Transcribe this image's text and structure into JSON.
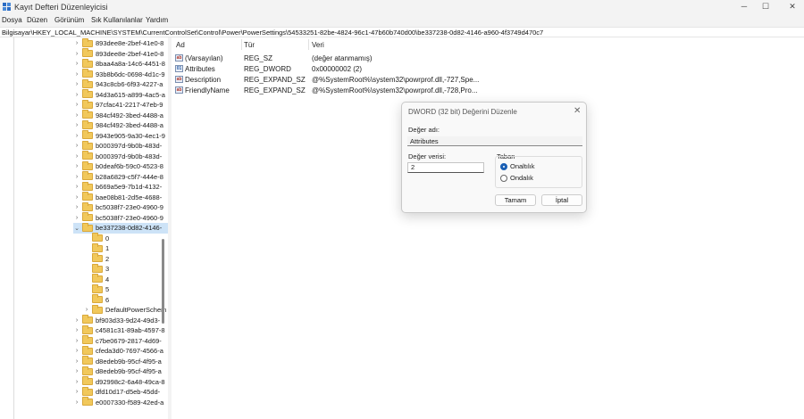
{
  "window": {
    "title": "Kayıt Defteri Düzenleyicisi",
    "minimize_glyph": "─",
    "maximize_glyph": "☐",
    "close_glyph": "✕",
    "icon": "registry-editor-icon"
  },
  "menu": [
    "Dosya",
    "Düzen",
    "Görünüm",
    "Sık Kullanılanlar",
    "Yardım"
  ],
  "address": "Bilgisayar\\HKEY_LOCAL_MACHINE\\SYSTEM\\CurrentControlSet\\Control\\Power\\PowerSettings\\54533251-82be-4824-96c1-47b60b740d00\\be337238-0d82-4146-a960-4f3749d470c7",
  "tree": {
    "chevron_collapsed": "›",
    "chevron_expanded": "⌄",
    "items": [
      {
        "label": "893dee8e-2bef-41e0-8",
        "level": 0,
        "state": "collapsed"
      },
      {
        "label": "893dee8e-2bef-41e0-8",
        "level": 0,
        "state": "collapsed"
      },
      {
        "label": "8baa4a8a-14c6-4451-8",
        "level": 0,
        "state": "collapsed"
      },
      {
        "label": "93b8b6dc-0698-4d1c-9",
        "level": 0,
        "state": "collapsed"
      },
      {
        "label": "943c8cb6-6f93-4227-a",
        "level": 0,
        "state": "collapsed"
      },
      {
        "label": "94d3a615-a899-4ac5-a",
        "level": 0,
        "state": "collapsed"
      },
      {
        "label": "97cfac41-2217-47eb-9",
        "level": 0,
        "state": "collapsed"
      },
      {
        "label": "984cf492-3bed-4488-a",
        "level": 0,
        "state": "collapsed"
      },
      {
        "label": "984cf492-3bed-4488-a",
        "level": 0,
        "state": "collapsed"
      },
      {
        "label": "9943e905-9a30-4ec1-9",
        "level": 0,
        "state": "collapsed"
      },
      {
        "label": "b000397d-9b0b-483d-",
        "level": 0,
        "state": "collapsed"
      },
      {
        "label": "b000397d-9b0b-483d-",
        "level": 0,
        "state": "collapsed"
      },
      {
        "label": "b0deaf6b-59c0-4523-8",
        "level": 0,
        "state": "collapsed"
      },
      {
        "label": "b28a6829-c5f7-444e-8",
        "level": 0,
        "state": "collapsed"
      },
      {
        "label": "b669a5e9-7b1d-4132-",
        "level": 0,
        "state": "collapsed"
      },
      {
        "label": "bae08b81-2d5e-4688-",
        "level": 0,
        "state": "collapsed"
      },
      {
        "label": "bc5038f7-23e0-4960-9",
        "level": 0,
        "state": "collapsed"
      },
      {
        "label": "bc5038f7-23e0-4960-9",
        "level": 0,
        "state": "collapsed"
      },
      {
        "label": "be337238-0d82-4146-",
        "level": 0,
        "state": "expanded",
        "selected": true
      },
      {
        "label": "0",
        "level": 1,
        "state": "leaf"
      },
      {
        "label": "1",
        "level": 1,
        "state": "leaf"
      },
      {
        "label": "2",
        "level": 1,
        "state": "leaf"
      },
      {
        "label": "3",
        "level": 1,
        "state": "leaf"
      },
      {
        "label": "4",
        "level": 1,
        "state": "leaf"
      },
      {
        "label": "5",
        "level": 1,
        "state": "leaf"
      },
      {
        "label": "6",
        "level": 1,
        "state": "leaf"
      },
      {
        "label": "DefaultPowerSchem",
        "level": 1,
        "state": "collapsed"
      },
      {
        "label": "bf903d33-9d24-49d3-",
        "level": 0,
        "state": "collapsed"
      },
      {
        "label": "c4581c31-89ab-4597-8",
        "level": 0,
        "state": "collapsed"
      },
      {
        "label": "c7be0679-2817-4d69-",
        "level": 0,
        "state": "collapsed"
      },
      {
        "label": "cfeda3d0-7697-4566-a",
        "level": 0,
        "state": "collapsed"
      },
      {
        "label": "d8edeb9b-95cf-4f95-a",
        "level": 0,
        "state": "collapsed"
      },
      {
        "label": "d8edeb9b-95cf-4f95-a",
        "level": 0,
        "state": "collapsed"
      },
      {
        "label": "d92998c2-6a48-49ca-8",
        "level": 0,
        "state": "collapsed"
      },
      {
        "label": "dfd10d17-d5eb-45dd-",
        "level": 0,
        "state": "collapsed"
      },
      {
        "label": "e0007330-f589-42ed-a",
        "level": 0,
        "state": "collapsed"
      }
    ]
  },
  "values": {
    "columns": {
      "name": "Ad",
      "type": "Tür",
      "data": "Veri"
    },
    "rows": [
      {
        "icon": "string-value-icon",
        "icon_text": "ab",
        "name": "(Varsayılan)",
        "type": "REG_SZ",
        "data": "(değer atanmamış)"
      },
      {
        "icon": "binary-value-icon",
        "icon_text": "01",
        "name": "Attributes",
        "type": "REG_DWORD",
        "data": "0x00000002 (2)"
      },
      {
        "icon": "string-value-icon",
        "icon_text": "ab",
        "name": "Description",
        "type": "REG_EXPAND_SZ",
        "data": "@%SystemRoot%\\system32\\powrprof.dll,-727,Spe..."
      },
      {
        "icon": "string-value-icon",
        "icon_text": "ab",
        "name": "FriendlyName",
        "type": "REG_EXPAND_SZ",
        "data": "@%SystemRoot%\\system32\\powrprof.dll,-728,Pro..."
      }
    ]
  },
  "dialog": {
    "title": "DWORD (32 bit) Değerini Düzenle",
    "close_glyph": "✕",
    "value_name_label": "Değer adı:",
    "value_name": "Attributes",
    "value_data_label": "Değer verisi:",
    "value_data": "2",
    "base_label": "Taban",
    "base_options": [
      {
        "label": "Onaltılık",
        "checked": true
      },
      {
        "label": "Ondalık",
        "checked": false
      }
    ],
    "ok_label": "Tamam",
    "cancel_label": "İptal"
  },
  "colors": {
    "selection": "#cde3f7",
    "folder": "#f1c85b",
    "accent": "#1a5fb4"
  }
}
